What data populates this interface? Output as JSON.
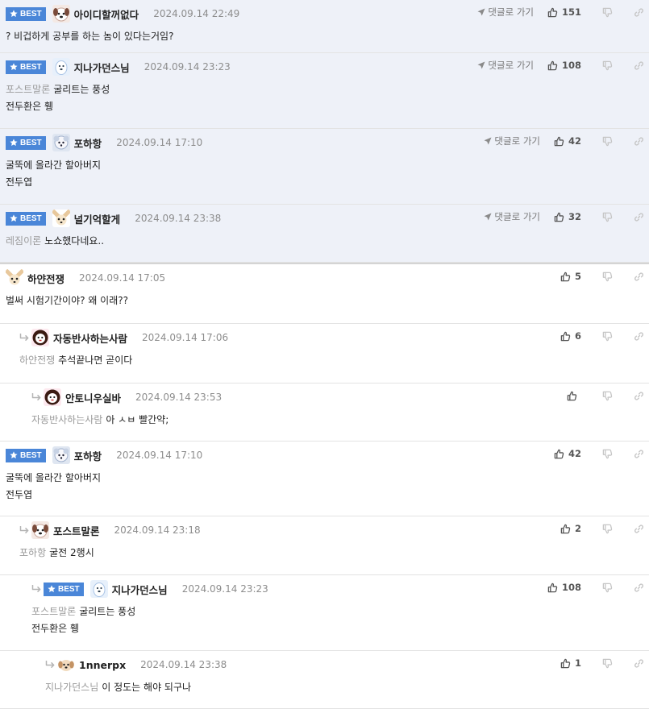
{
  "labels": {
    "best": "BEST",
    "goto": "댓글로 가기"
  },
  "colors": {
    "best_badge": "#4a86d8",
    "best_bg": "#eef1f8",
    "reply_target": "#9a9a9a"
  },
  "comments": [
    {
      "nick": "아이디할꺼없다",
      "date": "2024.09.14 22:49",
      "up": "151",
      "best": true,
      "goto": true,
      "avatar": "dog-face",
      "lines": [
        {
          "to": "",
          "text": "? 비겁하게 공부를 하는 놈이 있다는거임?"
        }
      ]
    },
    {
      "nick": "지나가던스님",
      "date": "2024.09.14 23:23",
      "up": "108",
      "best": true,
      "goto": true,
      "avatar": "white-dog",
      "lines": [
        {
          "to": "포스트말론",
          "text": "굴리트는 풍성"
        },
        {
          "to": "",
          "text": "전두환은 휑"
        }
      ]
    },
    {
      "nick": "포하항",
      "date": "2024.09.14 17:10",
      "up": "42",
      "best": true,
      "goto": true,
      "avatar": "fluffy-dog",
      "lines": [
        {
          "to": "",
          "text": "굴뚝에 올라간 할아버지"
        },
        {
          "to": "",
          "text": "전두엽"
        }
      ]
    },
    {
      "nick": "널기억할게",
      "date": "2024.09.14 23:38",
      "up": "32",
      "best": true,
      "goto": true,
      "avatar": "chihuahua",
      "lines": [
        {
          "to": "레짐이론",
          "text": "노쇼했다네요.."
        }
      ]
    },
    {
      "nick": "하얀전쟁",
      "date": "2024.09.14 17:05",
      "up": "5",
      "best": false,
      "goto": false,
      "avatar": "chihuahua",
      "lines": [
        {
          "to": "",
          "text": "벌써 시험기간이야? 왜 이래??"
        }
      ]
    },
    {
      "nick": "자동반사하는사람",
      "date": "2024.09.14 17:06",
      "up": "6",
      "best": false,
      "goto": false,
      "avatar": "lion",
      "lines": [
        {
          "to": "하얀전쟁",
          "text": "추석끝나면 곧이다"
        }
      ]
    },
    {
      "nick": "안토니우실바",
      "date": "2024.09.14 23:53",
      "up": "",
      "best": false,
      "goto": false,
      "avatar": "lion",
      "lines": [
        {
          "to": "자동반사하는사람",
          "text": "아 ㅅㅂ 빨간약;"
        }
      ]
    },
    {
      "nick": "포하항",
      "date": "2024.09.14 17:10",
      "up": "42",
      "best": true,
      "goto": false,
      "avatar": "fluffy-dog",
      "lines": [
        {
          "to": "",
          "text": "굴뚝에 올라간 할아버지"
        },
        {
          "to": "",
          "text": "전두엽"
        }
      ]
    },
    {
      "nick": "포스트말론",
      "date": "2024.09.14 23:18",
      "up": "2",
      "best": false,
      "goto": false,
      "avatar": "dog-face",
      "lines": [
        {
          "to": "포하항",
          "text": "굴전 2행시"
        }
      ]
    },
    {
      "nick": "지나가던스님",
      "date": "2024.09.14 23:23",
      "up": "108",
      "best": true,
      "goto": false,
      "avatar": "white-dog",
      "lines": [
        {
          "to": "포스트말론",
          "text": "굴리트는 풍성"
        },
        {
          "to": "",
          "text": "전두환은 휑"
        }
      ]
    },
    {
      "nick": "1nnerpx",
      "date": "2024.09.14 23:38",
      "up": "1",
      "best": false,
      "goto": false,
      "avatar": "puppy",
      "lines": [
        {
          "to": "지나가던스님",
          "text": "이 정도는 해야 되구나"
        }
      ]
    }
  ]
}
